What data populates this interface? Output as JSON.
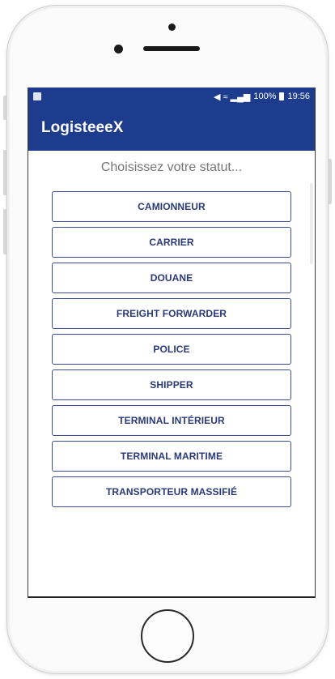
{
  "status_bar": {
    "signal_text": "◀ ≈ .∙∙",
    "battery_text": "100%",
    "time": "19:56"
  },
  "app_bar": {
    "title": "LogisteeeX"
  },
  "subtitle": "Choisissez votre statut...",
  "status_options": [
    {
      "label": "CAMIONNEUR"
    },
    {
      "label": "CARRIER"
    },
    {
      "label": "DOUANE"
    },
    {
      "label": "FREIGHT FORWARDER"
    },
    {
      "label": "POLICE"
    },
    {
      "label": "SHIPPER"
    },
    {
      "label": "TERMINAL INTÉRIEUR"
    },
    {
      "label": "TERMINAL MARITIME"
    },
    {
      "label": "TRANSPORTEUR MASSIFIÉ"
    }
  ],
  "colors": {
    "app_bar": "#1d3c8e",
    "button_border": "#3c4e8f",
    "button_text": "#2a3a78",
    "subtitle": "#777777"
  }
}
